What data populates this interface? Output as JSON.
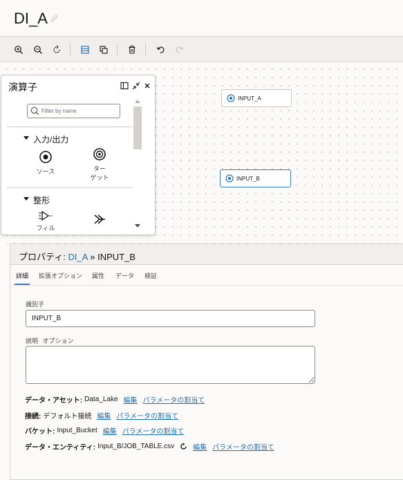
{
  "window": {
    "title": "DI_A"
  },
  "toolbar": {
    "buttons": [
      {
        "icon": "zoom-in-icon"
      },
      {
        "icon": "zoom-out-icon"
      },
      {
        "icon": "reset-view-icon"
      },
      {
        "icon": "panel-layout-icon"
      },
      {
        "icon": "copy-icon"
      },
      {
        "icon": "delete-icon"
      },
      {
        "icon": "undo-icon"
      },
      {
        "icon": "redo-icon"
      }
    ]
  },
  "palette": {
    "title": "演算子",
    "search_placeholder": "Filter by name",
    "sections": [
      {
        "label": "入力/出力",
        "items": [
          {
            "label": "ソース",
            "icon": "source-icon"
          },
          {
            "label": "ターゲット",
            "label_lines": [
              "ター",
              "ゲット"
            ],
            "icon": "target-icon"
          }
        ]
      },
      {
        "label": "整形",
        "items": [
          {
            "label": "フィル",
            "icon": "filter-icon"
          },
          {
            "label": "結合",
            "icon": "join-icon"
          }
        ]
      }
    ]
  },
  "canvas": {
    "nodes": [
      {
        "label": "INPUT_A",
        "selected": false
      },
      {
        "label": "INPUT_B",
        "selected": true
      }
    ]
  },
  "properties": {
    "prefix": "プロパティ:",
    "flow_link": "DI_A",
    "separator": "»",
    "node_name": "INPUT_B",
    "tabs": [
      "詳細",
      "拡張オプション",
      "属性",
      "データ",
      "検証"
    ],
    "active_tab": "詳細",
    "identifier_label": "識別子",
    "identifier_value": "INPUT_B",
    "description_label": "説明",
    "description_optional": "オプション",
    "rows": [
      {
        "key": "データ・アセット:",
        "value": "Data_Lake",
        "links": [
          "編集",
          "パラメータの割当て"
        ]
      },
      {
        "key": "接続:",
        "value": "デフォルト接続",
        "links": [
          "編集",
          "パラメータの割当て"
        ]
      },
      {
        "key": "バケット:",
        "value": "Input_Bucket",
        "links": [
          "編集",
          "パラメータの割当て"
        ]
      },
      {
        "key": "データ・エンティティ:",
        "value": "Input_B/JOB_TABLE.csv",
        "links": [
          "編集",
          "パラメータの割当て"
        ],
        "refresh": true
      }
    ]
  },
  "colors": {
    "accent": "#1f6fae",
    "selected_border": "#3a7ab5",
    "toolbar_bg": "#f1efed"
  }
}
